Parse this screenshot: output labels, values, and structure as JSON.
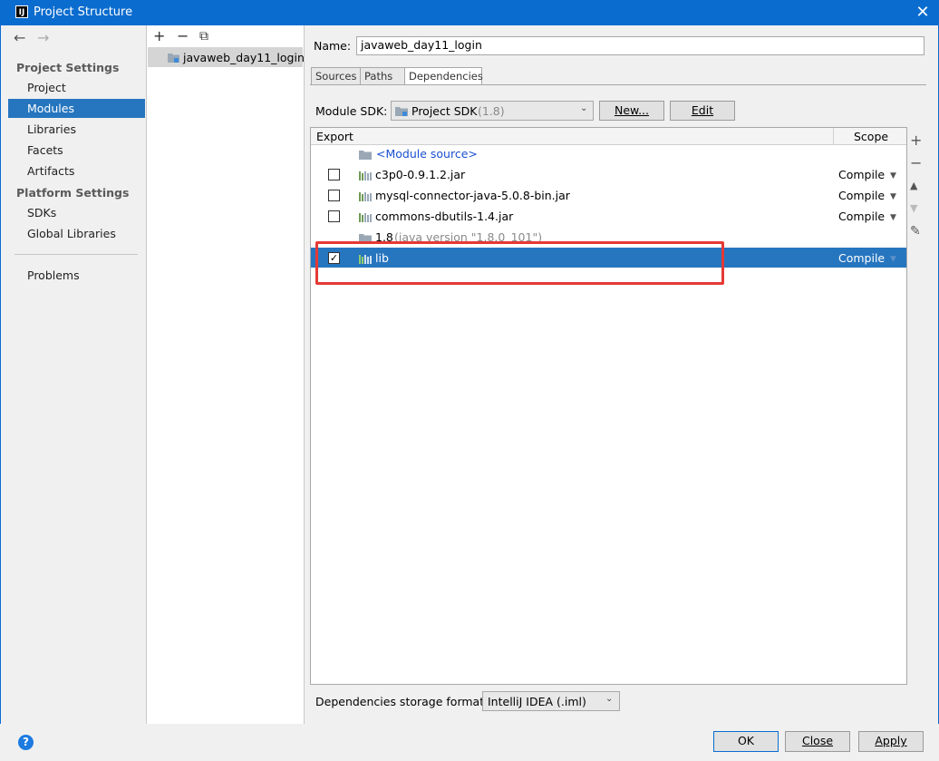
{
  "window": {
    "title": "Project Structure",
    "app_icon": "IJ"
  },
  "nav": {
    "back": "←",
    "forward": "→"
  },
  "left": {
    "section1": "Project Settings",
    "items1": [
      "Project",
      "Modules",
      "Libraries",
      "Facets",
      "Artifacts"
    ],
    "section2": "Platform Settings",
    "items2": [
      "SDKs",
      "Global Libraries"
    ],
    "problems": "Problems",
    "selected": "Modules"
  },
  "middle": {
    "toolbar": [
      "+",
      "−",
      "⧉"
    ],
    "module": "javaweb_day11_login"
  },
  "form": {
    "name_label": "Name:",
    "name_value": "javaweb_day11_login",
    "tabs": [
      "Sources",
      "Paths",
      "Dependencies"
    ],
    "active_tab": "Dependencies",
    "sdk_label": "Module SDK:",
    "sdk_value": "Project SDK",
    "sdk_version": "(1.8)",
    "new_btn": "New...",
    "edit_btn": "Edit"
  },
  "table": {
    "col_export": "Export",
    "col_scope": "Scope",
    "rows": [
      {
        "name": "<Module source>",
        "checkbox": false,
        "scope": ""
      },
      {
        "name": "c3p0-0.9.1.2.jar",
        "checkbox": true,
        "checked": false,
        "scope": "Compile"
      },
      {
        "name": "mysql-connector-java-5.0.8-bin.jar",
        "checkbox": true,
        "checked": false,
        "scope": "Compile"
      },
      {
        "name": "commons-dbutils-1.4.jar",
        "checkbox": true,
        "checked": false,
        "scope": "Compile"
      },
      {
        "name": "1.8",
        "extra": "(java version \"1.8.0_101\")",
        "checkbox": false,
        "scope": ""
      },
      {
        "name": "lib",
        "checkbox": true,
        "checked": true,
        "scope": "Compile",
        "selected": true
      }
    ],
    "side_buttons": [
      "+",
      "−",
      "▲",
      "▼",
      "✎"
    ]
  },
  "storage": {
    "label": "Dependencies storage format:",
    "value": "IntelliJ IDEA (.iml)"
  },
  "buttons": {
    "ok": "OK",
    "close": "Close",
    "apply": "Apply",
    "help": "?"
  },
  "colors": {
    "accent": "#0a6ccf",
    "selection": "#2675bf",
    "highlight_box": "#e53935"
  }
}
